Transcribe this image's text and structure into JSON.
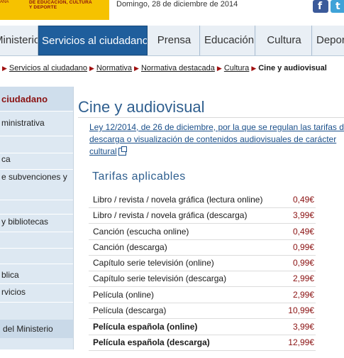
{
  "header": {
    "logo_line1": "DE EDUCACIÓN, CULTURA",
    "logo_line2": "Y DEPORTE",
    "logo_mark": "ANA",
    "date": "Domingo, 28 de diciembre de 2014",
    "social": [
      {
        "name": "facebook-icon",
        "glyph": "f",
        "color": "#3b5a9a"
      },
      {
        "name": "twitter-icon",
        "glyph": "t",
        "color": "#3fa3d8"
      }
    ]
  },
  "nav": {
    "items": [
      {
        "label": "Ministerio"
      },
      {
        "label": "Servicios al ciudadano",
        "active": true
      },
      {
        "label": "Prensa"
      },
      {
        "label": "Educación"
      },
      {
        "label": "Cultura"
      },
      {
        "label": "Deportes"
      }
    ]
  },
  "breadcrumb": {
    "items": [
      "Servicios al ciudadano",
      "Normativa",
      "Normativa destacada",
      "Cultura"
    ],
    "current": "Cine y audiovisual"
  },
  "sidebar": {
    "title": "ciudadano",
    "items": [
      "ministrativa",
      "",
      "ca",
      "e subvenciones y",
      "",
      "y bibliotecas",
      "",
      "",
      "blica",
      "rvicios"
    ],
    "footer": "del Ministerio"
  },
  "content": {
    "title": "Cine y audiovisual",
    "law_link": "Ley 12/2014, de 26 de diciembre, por la que se regulan las tarifas de descarga o visualización de contenidos audiovisuales de carácter cultural",
    "section_title": "Tarifas aplicables",
    "rows": [
      {
        "name": "Libro / revista / novela gráfica (lectura online)",
        "price": "0,49€",
        "bold": false
      },
      {
        "name": "Libro / revista / novela gráfica (descarga)",
        "price": "3,99€",
        "bold": false
      },
      {
        "name": "Canción (escucha online)",
        "price": "0,49€",
        "bold": false
      },
      {
        "name": "Canción (descarga)",
        "price": "0,99€",
        "bold": false
      },
      {
        "name": "Capítulo serie televisión (online)",
        "price": "0,99€",
        "bold": false
      },
      {
        "name": "Capítulo serie televisión (descarga)",
        "price": "2,99€",
        "bold": false
      },
      {
        "name": "Película (online)",
        "price": "2,99€",
        "bold": false
      },
      {
        "name": "Película (descarga)",
        "price": "10,99€",
        "bold": false
      },
      {
        "name": "Película española (online)",
        "price": "3,99€",
        "bold": true
      },
      {
        "name": "Película española (descarga)",
        "price": "12,99€",
        "bold": true
      }
    ]
  },
  "colors": {
    "nav_active": "#1f5e9c",
    "title_blue": "#2f5f8f",
    "price_red": "#8a1010",
    "sidebar_bg": "#dde8f2"
  }
}
